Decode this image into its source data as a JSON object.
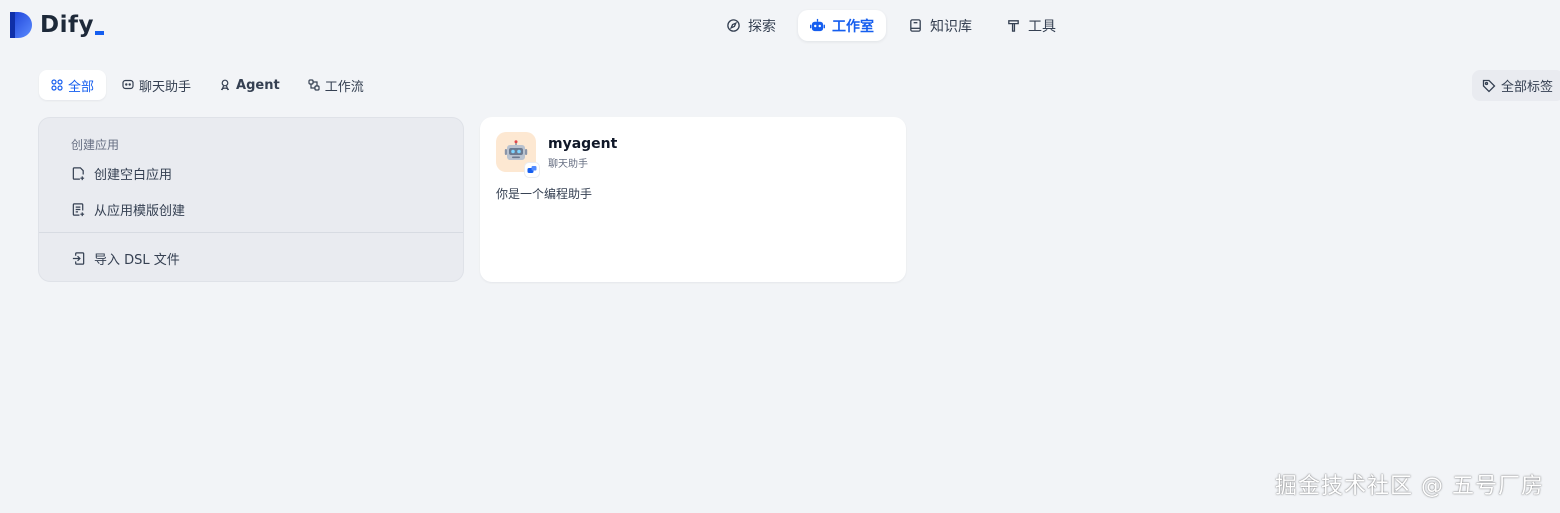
{
  "brand": {
    "name": "Dify",
    "accent": "#155eef"
  },
  "nav": [
    {
      "label": "探索",
      "icon": "compass-icon",
      "active": false
    },
    {
      "label": "工作室",
      "icon": "robot-icon",
      "active": true
    },
    {
      "label": "知识库",
      "icon": "book-icon",
      "active": false
    },
    {
      "label": "工具",
      "icon": "hammer-icon",
      "active": false
    }
  ],
  "tabs": [
    {
      "label": "全部",
      "icon": "grid-icon",
      "active": true
    },
    {
      "label": "聊天助手",
      "icon": "chat-bubble-icon",
      "active": false
    },
    {
      "label": "Agent",
      "icon": "agent-icon",
      "active": false
    },
    {
      "label": "工作流",
      "icon": "workflow-icon",
      "active": false
    }
  ],
  "tag_filter": {
    "label": "全部标签",
    "icon": "tag-icon"
  },
  "create": {
    "title": "创建应用",
    "blank_label": "创建空白应用",
    "template_label": "从应用模版创建",
    "import_label": "导入 DSL 文件"
  },
  "apps": [
    {
      "name": "myagent",
      "mode": "聊天助手",
      "description": "你是一个编程助手",
      "icon": "robot-emoji-icon",
      "badge_icon": "chat-badge-icon"
    }
  ],
  "watermark": "掘金技术社区 @ 五号厂房"
}
